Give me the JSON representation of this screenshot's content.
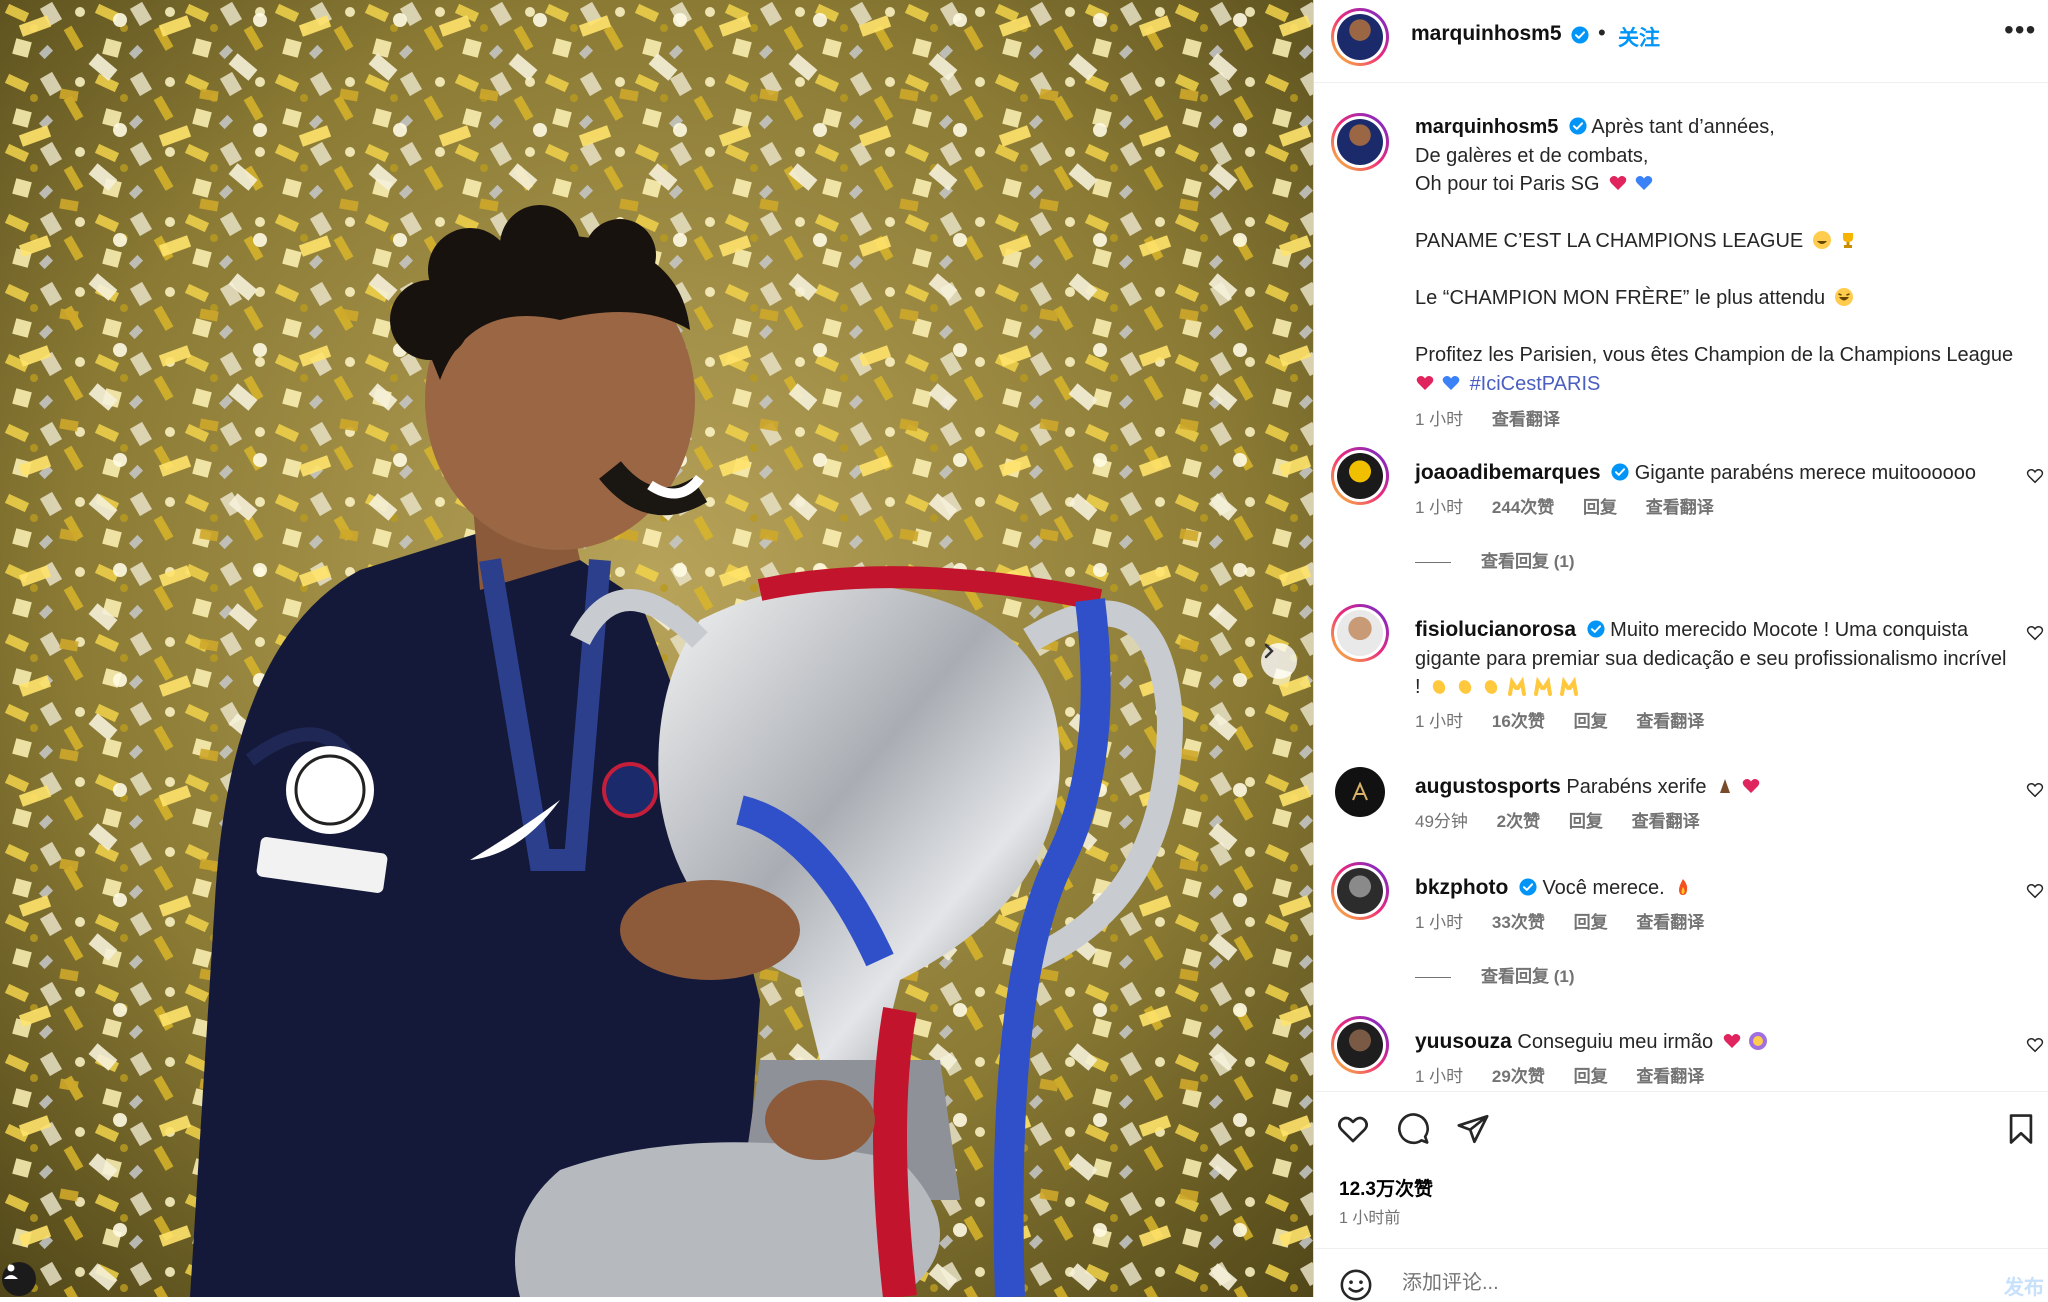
{
  "post": {
    "username": "marquinhosm5",
    "follow_label": "关注",
    "separator": "•",
    "more_label": "•••",
    "caption_lines": [
      "Après tant d’années,",
      "De galères et de combats,",
      "Oh pour toi Paris SG"
    ],
    "caption_line4": "PANAME C’EST LA CHAMPIONS LEAGUE",
    "caption_line5": "Le “CHAMPION MON FRÈRE” le plus attendu",
    "caption_line6": "Profitez les Parisien, vous êtes Champion de la Champions League",
    "hashtag": "#IciCestPARIS",
    "caption_time": "1 小时",
    "translate_label": "查看翻译",
    "likes": "12.3万次赞",
    "posted_ago": "1 小时前",
    "add_comment_placeholder": "添加评论...",
    "post_button": "发布"
  },
  "comments": [
    {
      "username": "joaoadibemarques",
      "verified": true,
      "text": "Gigante parabéns merece muitoooooo",
      "time": "1 小时",
      "likes": "244次赞",
      "reply": "回复",
      "translate": "查看翻译",
      "view_replies": "查看回复 (1)"
    },
    {
      "username": "fisiolucianorosa",
      "verified": true,
      "text": "Muito merecido Mocote ! Uma conquista gigante para premiar sua dedicação e seu profissionalismo incrível !",
      "time": "1 小时",
      "likes": "16次赞",
      "reply": "回复",
      "translate": "查看翻译"
    },
    {
      "username": "augustosports",
      "verified": false,
      "text": "Parabéns xerife",
      "time": "49分钟",
      "likes": "2次赞",
      "reply": "回复",
      "translate": "查看翻译"
    },
    {
      "username": "bkzphoto",
      "verified": true,
      "text": "Você merece.",
      "time": "1 小时",
      "likes": "33次赞",
      "reply": "回复",
      "translate": "查看翻译",
      "view_replies": "查看回复 (1)"
    },
    {
      "username": "yuusouza",
      "verified": false,
      "text": "Conseguiu meu irmão",
      "time": "1 小时",
      "likes": "29次赞",
      "reply": "回复",
      "translate": "查看翻译"
    }
  ],
  "icons": [
    "verified-badge-icon",
    "like-heart-icon",
    "comment-icon",
    "share-icon",
    "bookmark-icon",
    "smile-icon",
    "chevron-right-icon",
    "tag-user-icon",
    "more-options-icon"
  ],
  "colors": {
    "accent_blue": "#0095f6",
    "hashtag": "#4a5fc1",
    "meta_gray": "#737373",
    "heart_red": "#e0245e",
    "heart_blue": "#3b82f6"
  }
}
